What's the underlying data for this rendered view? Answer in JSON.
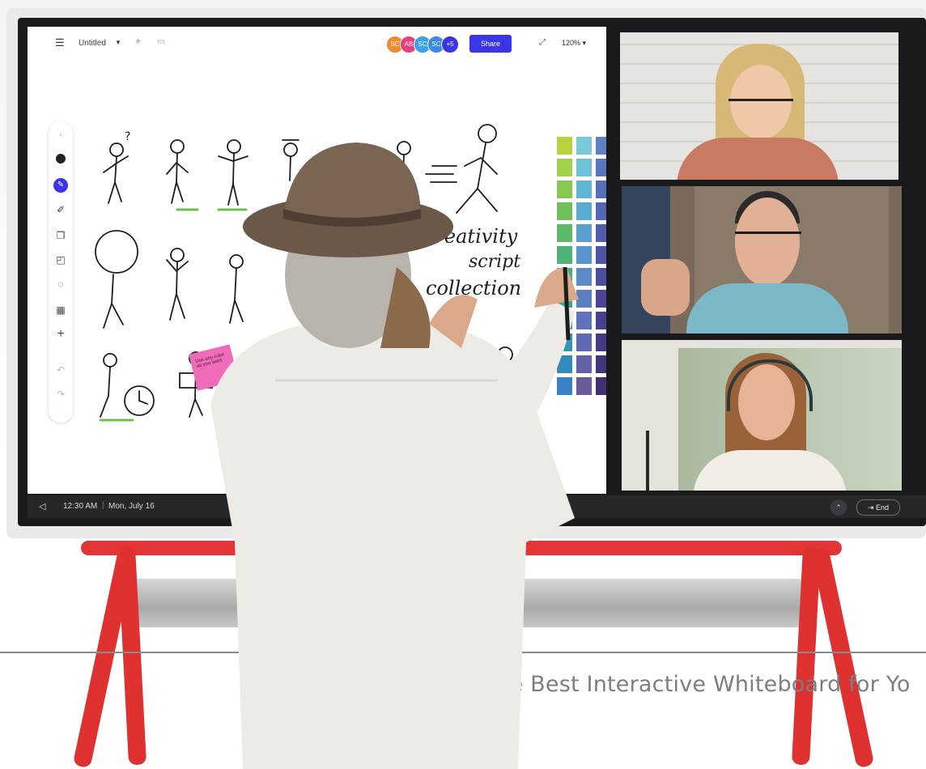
{
  "board": {
    "doc_title": "Untitled",
    "share_label": "Share",
    "zoom_label": "120%",
    "avatars": [
      {
        "initials": "SC",
        "color": "#f08a2c"
      },
      {
        "initials": "AB",
        "color": "#e8407a"
      },
      {
        "initials": "SC",
        "color": "#3aa0e8"
      },
      {
        "initials": "SC",
        "color": "#3a8ae8"
      },
      {
        "initials": "+5",
        "color": "#3a35e8"
      }
    ],
    "sticky_note_text": "Use any color as you want",
    "handwriting": [
      "creativity",
      "script",
      "collection"
    ],
    "colors": {
      "share_button": "#3a35e8",
      "sticky_note": "#f06cb8"
    },
    "palette_columns": [
      [
        "#b7d23a",
        "#9fd14a",
        "#86c94f",
        "#6fc05a",
        "#5cba66",
        "#4fb377",
        "#46ad86",
        "#3fa797",
        "#3aa0a6",
        "#3596b3",
        "#348cbc",
        "#3a80c4"
      ],
      [
        "#79c9d8",
        "#6dc0d5",
        "#5fb5d3",
        "#59aad1",
        "#599fd0",
        "#5a94cc",
        "#5a8ac8",
        "#5c7fc2",
        "#5e73bb",
        "#6168b2",
        "#6460a8",
        "#6a5b9d"
      ],
      [
        "#5d7fc3",
        "#5a77be",
        "#566fb8",
        "#5366b2",
        "#505dac",
        "#4e55a5",
        "#4b4d9e",
        "#494697",
        "#47408f",
        "#453a86",
        "#43357d",
        "#413074"
      ]
    ]
  },
  "statusbar": {
    "time": "12:30 AM",
    "date": "Mon, July 16",
    "end_label": "End"
  },
  "caption": "How to Find the Best Interactive Whiteboard for Yo"
}
